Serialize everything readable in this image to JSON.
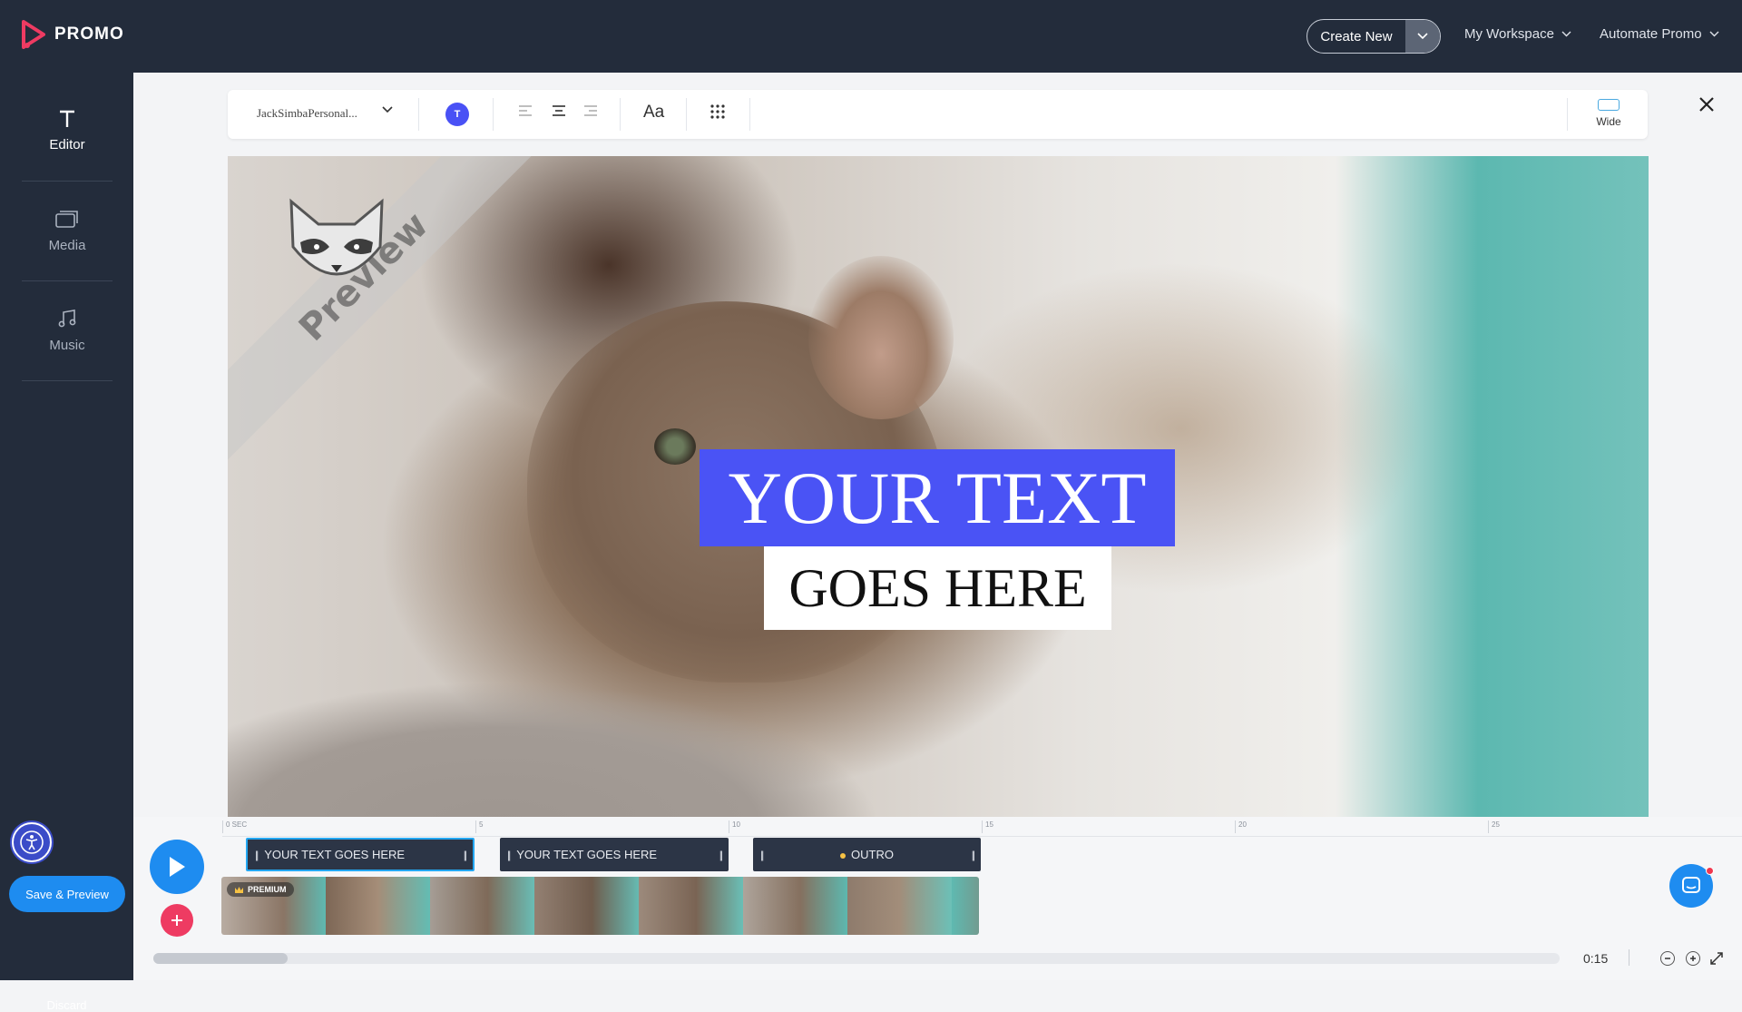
{
  "brand": {
    "name": "PROMO",
    "accent": "#ee3b62"
  },
  "header": {
    "create_new": "Create New",
    "workspace": "My Workspace",
    "automate": "Automate Promo"
  },
  "sidebar": {
    "items": [
      {
        "label": "Editor",
        "icon": "text-t-icon"
      },
      {
        "label": "Media",
        "icon": "media-stack-icon"
      },
      {
        "label": "Music",
        "icon": "music-note-icon"
      }
    ],
    "save_preview": "Save & Preview",
    "discard": "Discard"
  },
  "toolbar": {
    "font_name": "JackSimbaPersonal...",
    "color_letter": "T",
    "aspect": "Wide",
    "text_style": "Aa"
  },
  "canvas": {
    "line1": "YOUR TEXT",
    "line2": "GOES HERE",
    "watermark": "Preview",
    "text_bg_color": "#4a53f5"
  },
  "timeline": {
    "ticks": [
      "0 SEC",
      "5",
      "10",
      "15",
      "20",
      "25"
    ],
    "clips": [
      {
        "label": "YOUR TEXT GOES HERE",
        "selected": true
      },
      {
        "label": "YOUR TEXT GOES HERE",
        "selected": false
      },
      {
        "label": "OUTRO",
        "selected": false
      }
    ],
    "premium_badge": "PREMIUM",
    "duration": "0:15"
  }
}
